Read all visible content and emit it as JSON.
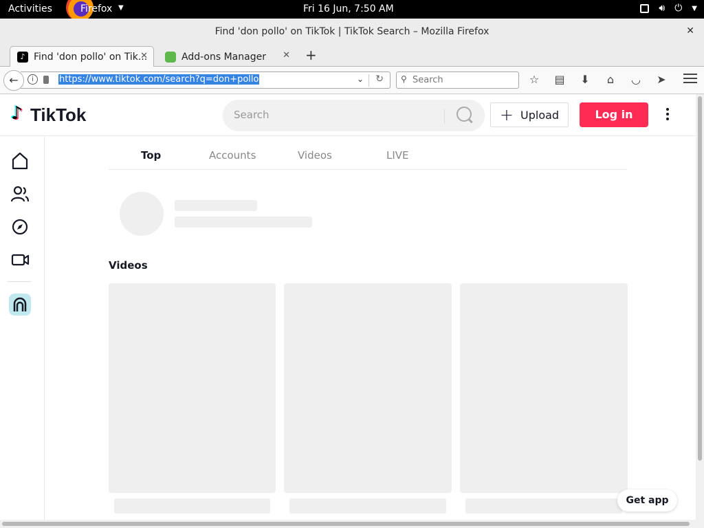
{
  "system": {
    "activities": "Activities",
    "app_menu": "Firefox",
    "clock": "Fri 16 Jun,  7:50 AM"
  },
  "window": {
    "title": "Find 'don pollo' on TikTok | TikTok Search – Mozilla Firefox"
  },
  "tabs": [
    {
      "label": "Find 'don pollo' on Tik...",
      "icon": "tiktok-favicon",
      "active": true
    },
    {
      "label": "Add-ons Manager",
      "icon": "puzzle-icon",
      "active": false
    }
  ],
  "navbar": {
    "url": "https://www.tiktok.com/search?q=don+pollo",
    "search_placeholder": "Search"
  },
  "tiktok": {
    "logo_text": "TikTok",
    "search_placeholder": "Search",
    "upload_label": "Upload",
    "login_label": "Log in",
    "brand_color": "#fe2c55",
    "result_tabs": [
      "Top",
      "Accounts",
      "Videos",
      "LIVE"
    ],
    "videos_heading": "Videos",
    "get_app": "Get app"
  }
}
